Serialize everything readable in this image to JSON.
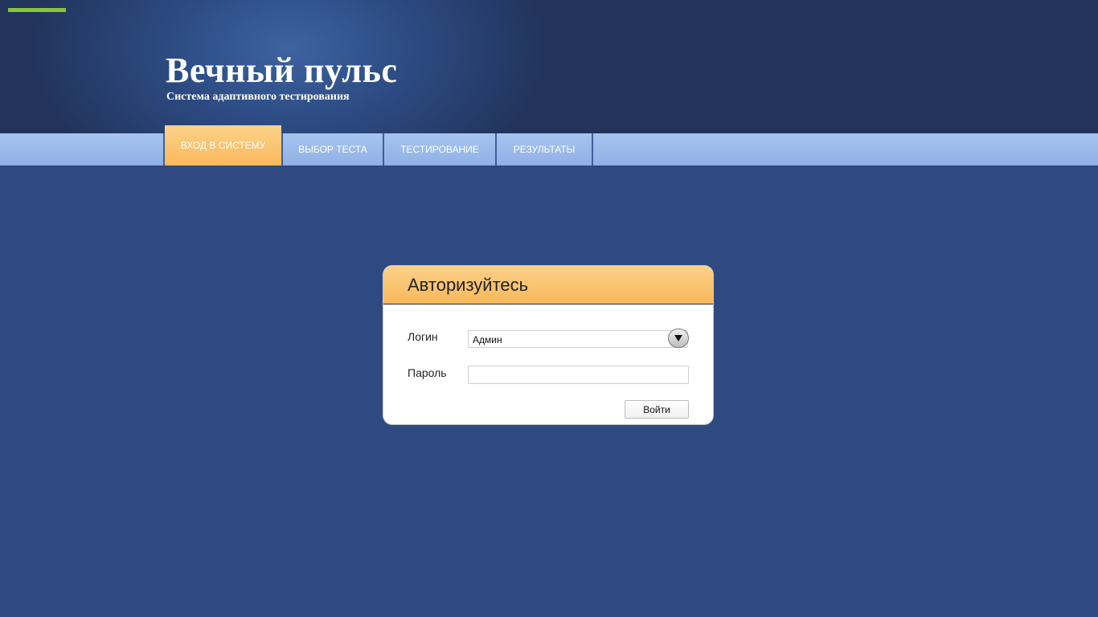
{
  "header": {
    "title": "Вечный пульс",
    "subtitle": "Система адаптивного тестирования"
  },
  "nav": {
    "tabs": [
      {
        "label": "ВХОД В СИСТЕМУ",
        "active": true
      },
      {
        "label": "ВЫБОР ТЕСТА",
        "active": false
      },
      {
        "label": "ТЕСТИРОВАНИЕ",
        "active": false
      },
      {
        "label": "РЕЗУЛЬТАТЫ",
        "active": false
      }
    ]
  },
  "login": {
    "title": "Авторизуйтесь",
    "login_label": "Логин",
    "login_value": "Админ",
    "password_label": "Пароль",
    "password_value": "",
    "submit_label": "Войти"
  },
  "colors": {
    "background": "#2e4a80",
    "nav_bar": "#9bbcec",
    "active_tab": "#f9b85b",
    "accent": "#8ac43a"
  },
  "icons": {
    "dropdown_arrow": "triangle-down-icon"
  }
}
